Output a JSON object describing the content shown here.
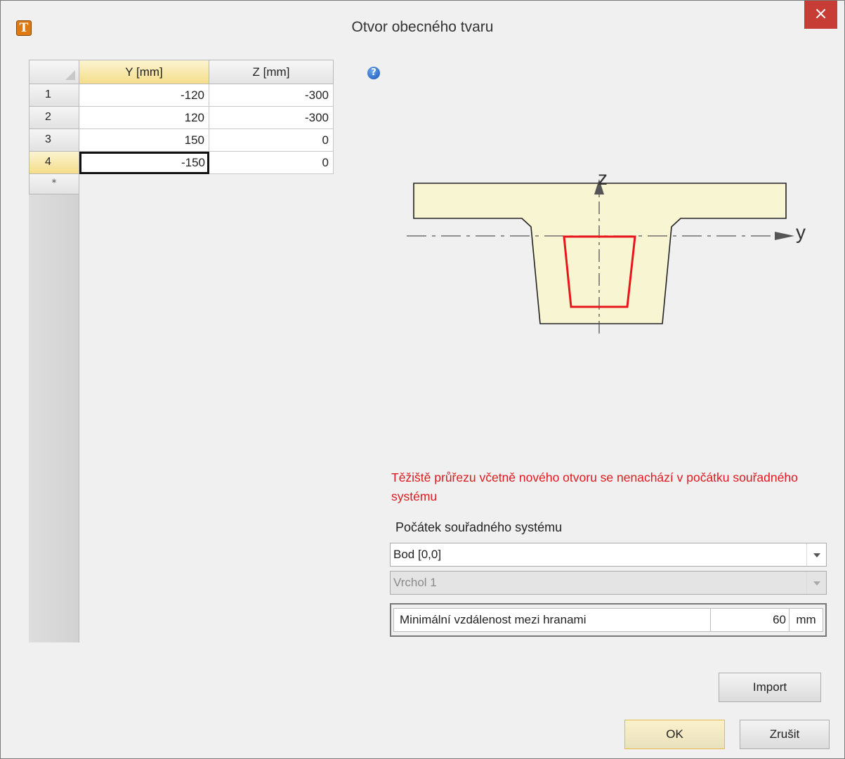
{
  "window": {
    "title": "Otvor obecného tvaru",
    "close_glyph": "×",
    "app_icon_glyph": "T"
  },
  "grid": {
    "columns": [
      "Y [mm]",
      "Z [mm]"
    ],
    "rows": [
      {
        "n": "1",
        "y": "-120",
        "z": "-300"
      },
      {
        "n": "2",
        "y": "120",
        "z": "-300"
      },
      {
        "n": "3",
        "y": "150",
        "z": "0"
      },
      {
        "n": "4",
        "y": "-150",
        "z": "0"
      }
    ],
    "new_row_marker": "*",
    "help_glyph": "?"
  },
  "diagram": {
    "axis_z_label": "z",
    "axis_y_label": "y",
    "colors": {
      "section_fill": "#f8f5d2",
      "section_stroke": "#222222",
      "opening_stroke": "#e8161b",
      "axis": "#555555"
    }
  },
  "warning": "Těžiště průřezu včetně nového otvoru se nenachází v počátku souřadného systému",
  "origin": {
    "label": "Počátek souřadného systému",
    "combo1_value": "Bod [0,0]",
    "combo2_value": "Vrchol 1"
  },
  "min_distance": {
    "label": "Minimální vzdálenost mezi hranami",
    "value": "60",
    "unit": "mm"
  },
  "buttons": {
    "import": "Import",
    "ok": "OK",
    "cancel": "Zrušit"
  }
}
